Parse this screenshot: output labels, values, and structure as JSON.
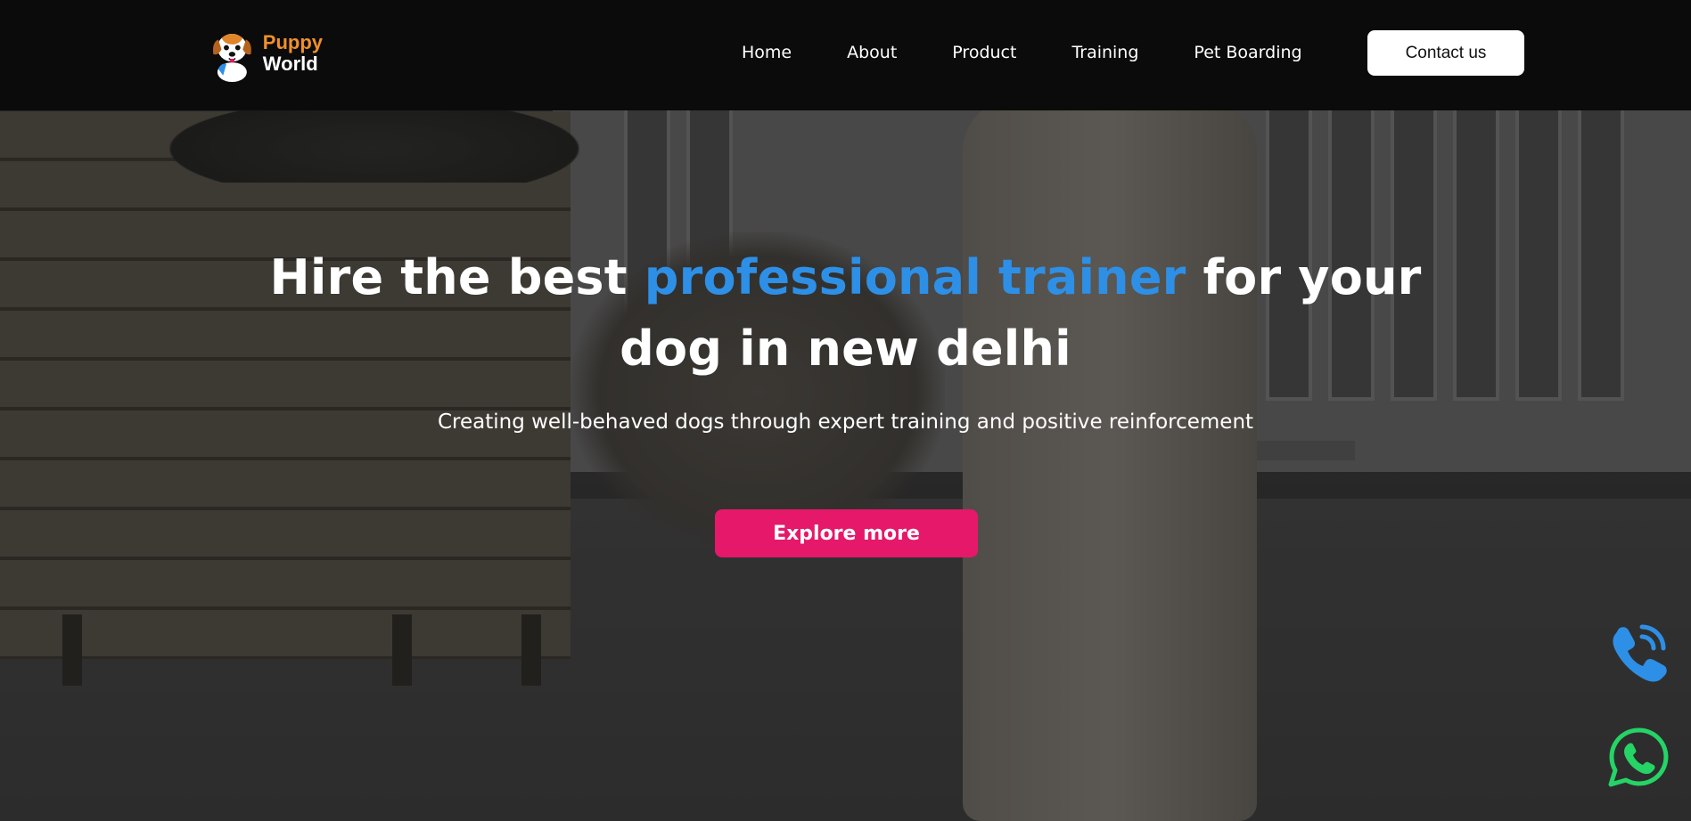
{
  "brand": {
    "logo_line1": "Puppy",
    "logo_line2": "World",
    "logo_icon": "cartoon-dog-icon"
  },
  "nav": {
    "items": [
      {
        "label": "Home"
      },
      {
        "label": "About"
      },
      {
        "label": "Product"
      },
      {
        "label": "Training"
      },
      {
        "label": "Pet Boarding"
      }
    ],
    "contact_label": "Contact us"
  },
  "hero": {
    "title_before": "Hire the best ",
    "title_accent": "professional trainer",
    "title_after": " for your dog in new delhi",
    "subtitle": "Creating well-behaved dogs through expert training and positive reinforcement",
    "cta_label": "Explore more"
  },
  "floating": {
    "phone_icon": "phone-call-icon",
    "whatsapp_icon": "whatsapp-icon"
  },
  "colors": {
    "header_bg": "#0b0b0b",
    "accent_blue": "#2e8fe6",
    "cta_pink": "#e5186a",
    "logo_orange": "#f0902a",
    "whatsapp_green": "#25d366"
  }
}
